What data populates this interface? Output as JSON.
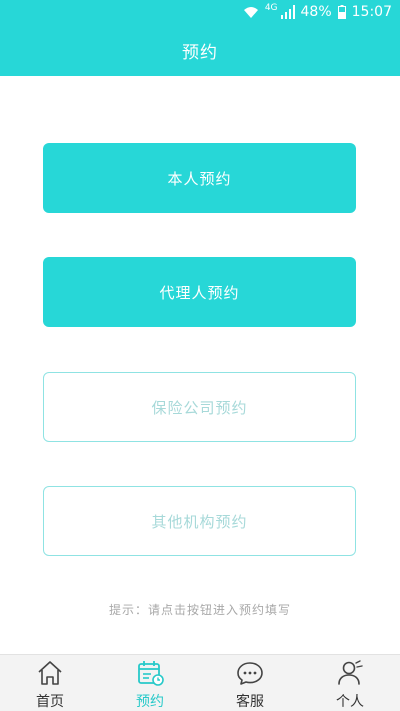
{
  "status_bar": {
    "network": "4G",
    "battery": "48%",
    "time": "15:07"
  },
  "header": {
    "title": "预约"
  },
  "options": [
    {
      "label": "本人预约",
      "style": "filled"
    },
    {
      "label": "代理人预约",
      "style": "filled"
    },
    {
      "label": "保险公司预约",
      "style": "outline"
    },
    {
      "label": "其他机构预约",
      "style": "outline"
    }
  ],
  "hint": "提示：请点击按钮进入预约填写",
  "tabbar": {
    "items": [
      {
        "label": "首页",
        "icon": "home-icon",
        "active": false
      },
      {
        "label": "预约",
        "icon": "calendar-icon",
        "active": true
      },
      {
        "label": "客服",
        "icon": "chat-icon",
        "active": false
      },
      {
        "label": "个人",
        "icon": "user-icon",
        "active": false
      }
    ]
  },
  "colors": {
    "accent": "#27d7d7",
    "outline": "#8fe3e3",
    "tabbar_bg": "#f3f3f3"
  }
}
